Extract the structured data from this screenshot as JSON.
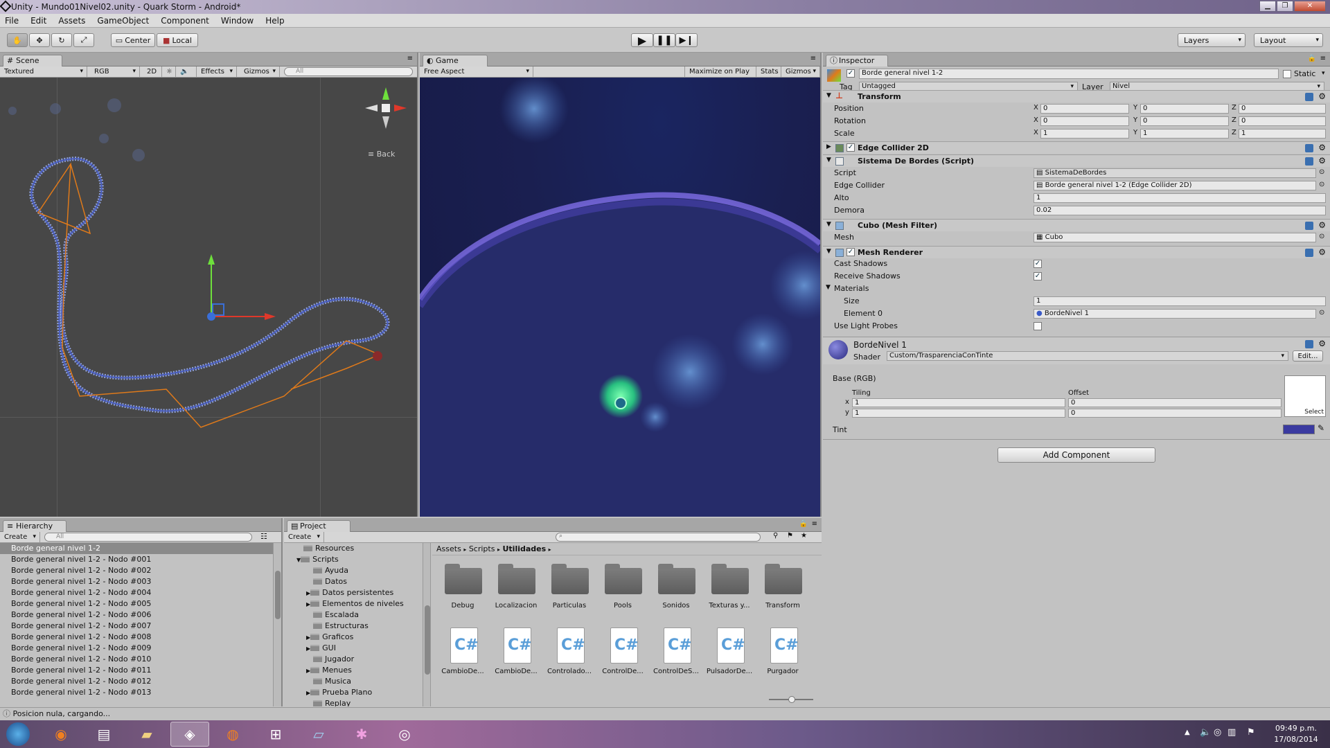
{
  "window": {
    "title": "Unity - Mundo01Nivel02.unity - Quark Storm - Android*",
    "minimize": "▁",
    "restore": "❐",
    "close": "✕"
  },
  "menu": [
    "File",
    "Edit",
    "Assets",
    "GameObject",
    "Component",
    "Window",
    "Help"
  ],
  "toolbar": {
    "center": "Center",
    "local": "Local",
    "layers": "Layers",
    "layout": "Layout"
  },
  "scene": {
    "tab": "Scene",
    "render_mode": "Textured",
    "color_mode": "RGB",
    "mode_2d": "2D",
    "effects": "Effects",
    "gizmos": "Gizmos",
    "search_placeholder": "All",
    "gizmo_back": "Back"
  },
  "game": {
    "tab": "Game",
    "aspect": "Free Aspect",
    "maximize": "Maximize on Play",
    "stats": "Stats",
    "gizmos": "Gizmos"
  },
  "inspector": {
    "tab": "Inspector",
    "object_name": "Borde general nivel 1-2",
    "static_label": "Static",
    "tag_label": "Tag",
    "tag_value": "Untagged",
    "layer_label": "Layer",
    "layer_value": "Nivel",
    "transform": {
      "title": "Transform",
      "position": {
        "label": "Position",
        "x": "0",
        "y": "0",
        "z": "0"
      },
      "rotation": {
        "label": "Rotation",
        "x": "0",
        "y": "0",
        "z": "0"
      },
      "scale": {
        "label": "Scale",
        "x": "1",
        "y": "1",
        "z": "1"
      }
    },
    "edge_collider": {
      "title": "Edge Collider 2D"
    },
    "sistema": {
      "title": "Sistema De Bordes (Script)",
      "script_label": "Script",
      "script_value": "SistemaDeBordes",
      "edge_label": "Edge Collider",
      "edge_value": "Borde general nivel 1-2 (Edge Collider 2D)",
      "alto_label": "Alto",
      "alto_value": "1",
      "demora_label": "Demora",
      "demora_value": "0.02"
    },
    "mesh_filter": {
      "title": "Cubo (Mesh Filter)",
      "mesh_label": "Mesh",
      "mesh_value": "Cubo"
    },
    "mesh_renderer": {
      "title": "Mesh Renderer",
      "cast_label": "Cast Shadows",
      "receive_label": "Receive Shadows",
      "materials_label": "Materials",
      "size_label": "Size",
      "size_value": "1",
      "element_label": "Element 0",
      "element_value": "BordeNivel 1",
      "probes_label": "Use Light Probes"
    },
    "material": {
      "name": "BordeNivel 1",
      "shader_label": "Shader",
      "shader_value": "Custom/TrasparenciaConTinte",
      "edit": "Edit...",
      "base_label": "Base (RGB)",
      "tiling": "Tiling",
      "offset": "Offset",
      "x_label": "x",
      "y_label": "y",
      "tiling_x": "1",
      "tiling_y": "1",
      "offset_x": "0",
      "offset_y": "0",
      "select": "Select",
      "tint_label": "Tint",
      "tint_color": "#3a3aa0"
    },
    "add_component": "Add Component"
  },
  "hierarchy": {
    "tab": "Hierarchy",
    "create": "Create",
    "search_placeholder": "All",
    "items": [
      "Borde general nivel 1-2",
      "Borde general nivel 1-2 - Nodo #001",
      "Borde general nivel 1-2 - Nodo #002",
      "Borde general nivel 1-2 - Nodo #003",
      "Borde general nivel 1-2 - Nodo #004",
      "Borde general nivel 1-2 - Nodo #005",
      "Borde general nivel 1-2 - Nodo #006",
      "Borde general nivel 1-2 - Nodo #007",
      "Borde general nivel 1-2 - Nodo #008",
      "Borde general nivel 1-2 - Nodo #009",
      "Borde general nivel 1-2 - Nodo #010",
      "Borde general nivel 1-2 - Nodo #011",
      "Borde general nivel 1-2 - Nodo #012",
      "Borde general nivel 1-2 - Nodo #013"
    ]
  },
  "project": {
    "tab": "Project",
    "create": "Create",
    "tree": [
      "Resources",
      "Scripts",
      "Ayuda",
      "Datos",
      "Datos persistentes",
      "Elementos de niveles",
      "Escalada",
      "Estructuras",
      "Graficos",
      "GUI",
      "Jugador",
      "Menues",
      "Musica",
      "Prueba Plano",
      "Replay"
    ],
    "breadcrumb": [
      "Assets",
      "Scripts",
      "Utilidades"
    ],
    "folders": [
      "Debug",
      "Localizacion",
      "Particulas",
      "Pools",
      "Sonidos",
      "Texturas y...",
      "Transform"
    ],
    "scripts": [
      "CambioDe...",
      "CambioDe...",
      "Controlado...",
      "ControlDe...",
      "ControlDeS...",
      "PulsadorDe...",
      "Purgador"
    ]
  },
  "status": "Posicion nula, cargando...",
  "taskbar": {
    "time": "09:49 p.m.",
    "date": "17/08/2014"
  }
}
